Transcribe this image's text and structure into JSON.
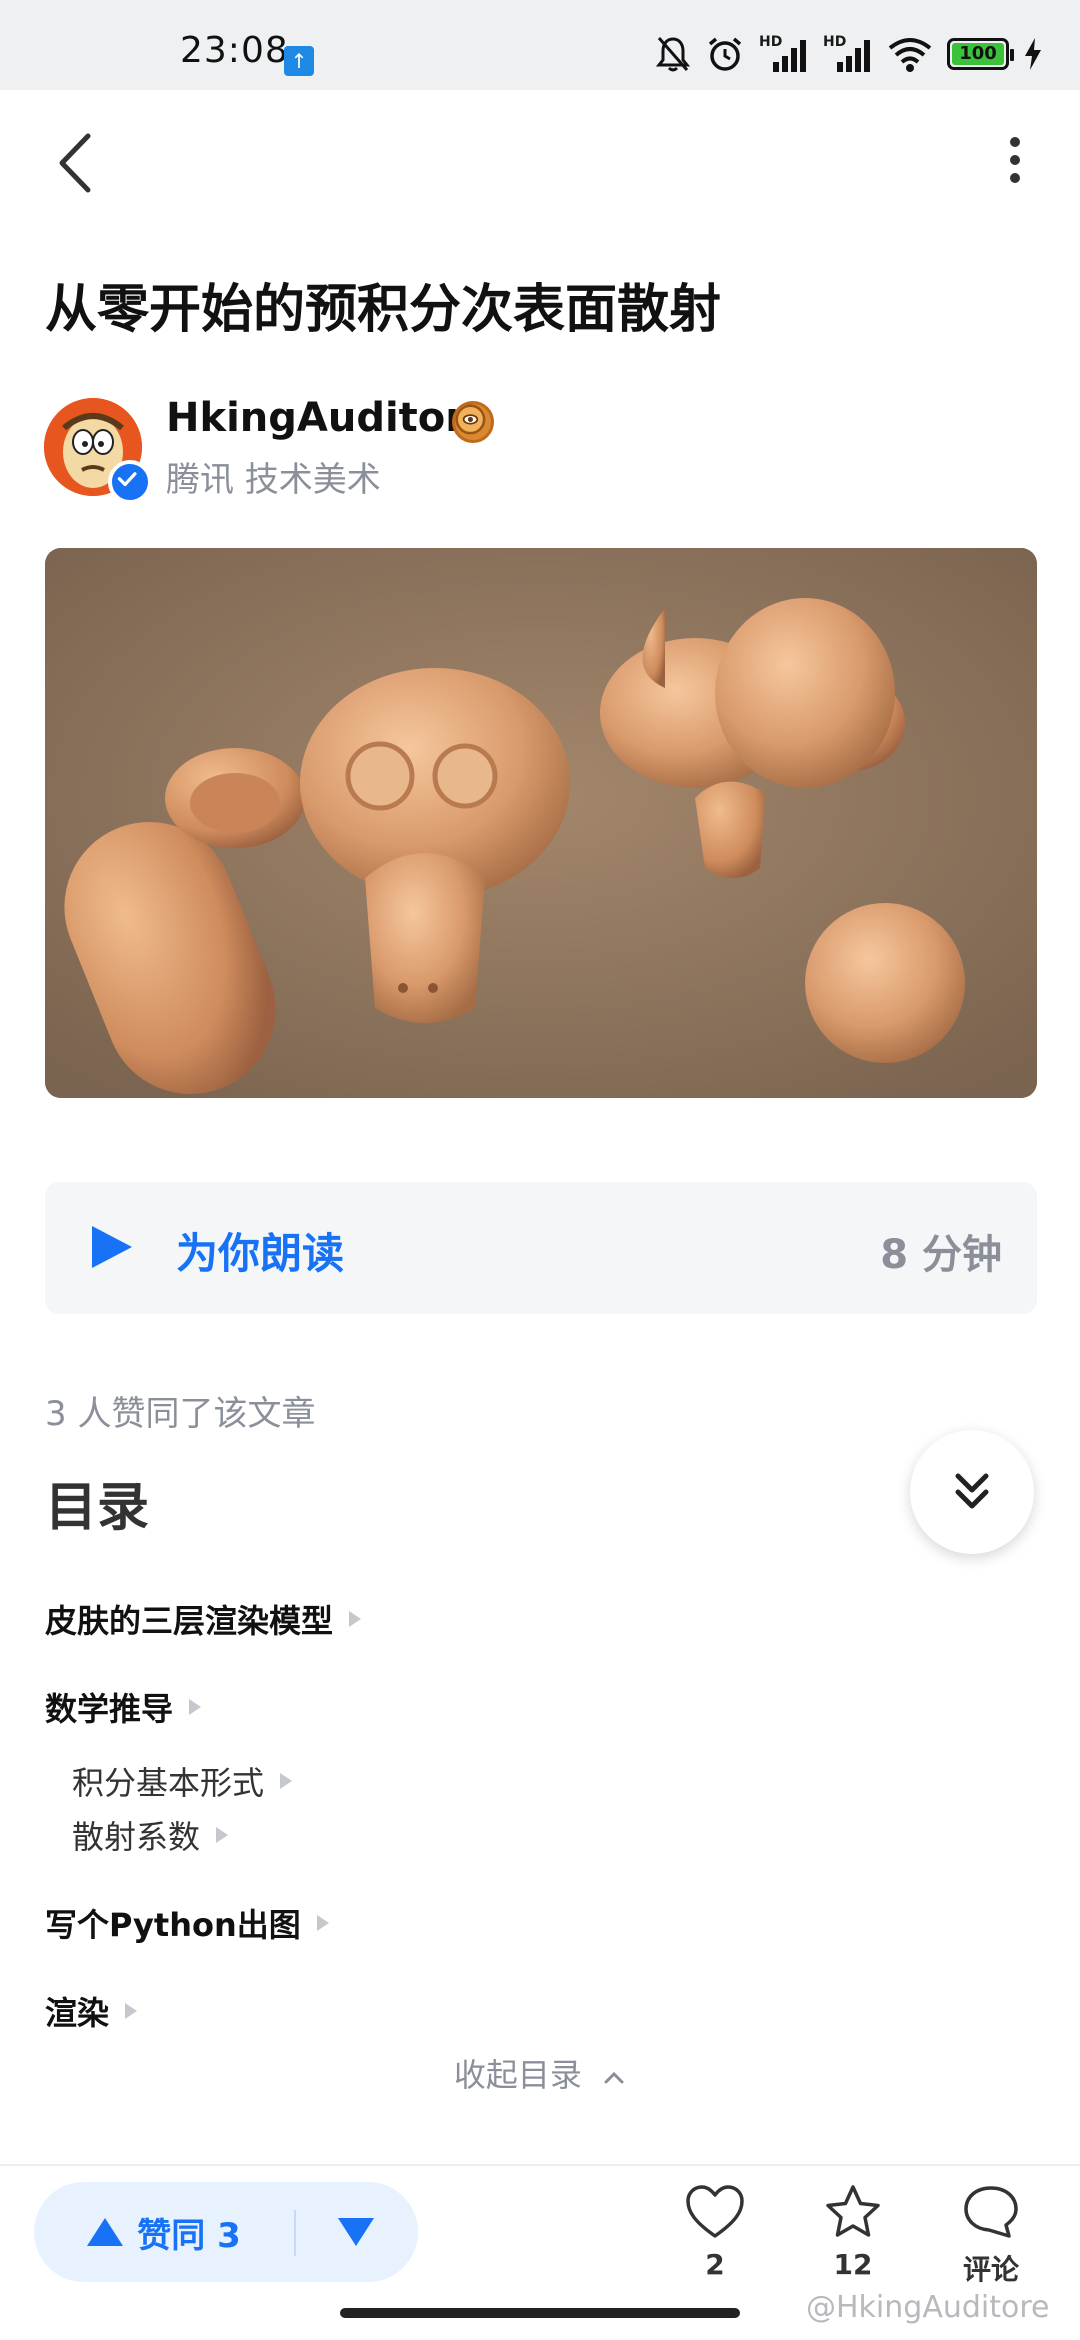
{
  "status_bar": {
    "time": "23:08",
    "network_1": "HD",
    "network_2": "HD",
    "battery": "100"
  },
  "article": {
    "title": "从零开始的预积分次表面散射"
  },
  "author": {
    "name": "HkingAuditore",
    "subtitle": "腾讯 技术美术"
  },
  "read_aloud": {
    "label": "为你朗读",
    "duration": "8 分钟"
  },
  "likes_note": "3 人赞同了该文章",
  "toc": {
    "title": "目录",
    "items": [
      {
        "label": "皮肤的三层渲染模型"
      },
      {
        "label": "数学推导"
      },
      {
        "label": "积分基本形式"
      },
      {
        "label": "散射系数"
      },
      {
        "label": "写个Python出图"
      },
      {
        "label": "渲染"
      }
    ],
    "collapse_label": "收起目录"
  },
  "bottom_bar": {
    "upvote_label": "赞同 3",
    "like_count": "2",
    "favorite_count": "12",
    "comment_label": "评论"
  },
  "watermark": "@HkingAuditore",
  "colors": {
    "accent": "#1772f6",
    "muted": "#8a8f99"
  }
}
